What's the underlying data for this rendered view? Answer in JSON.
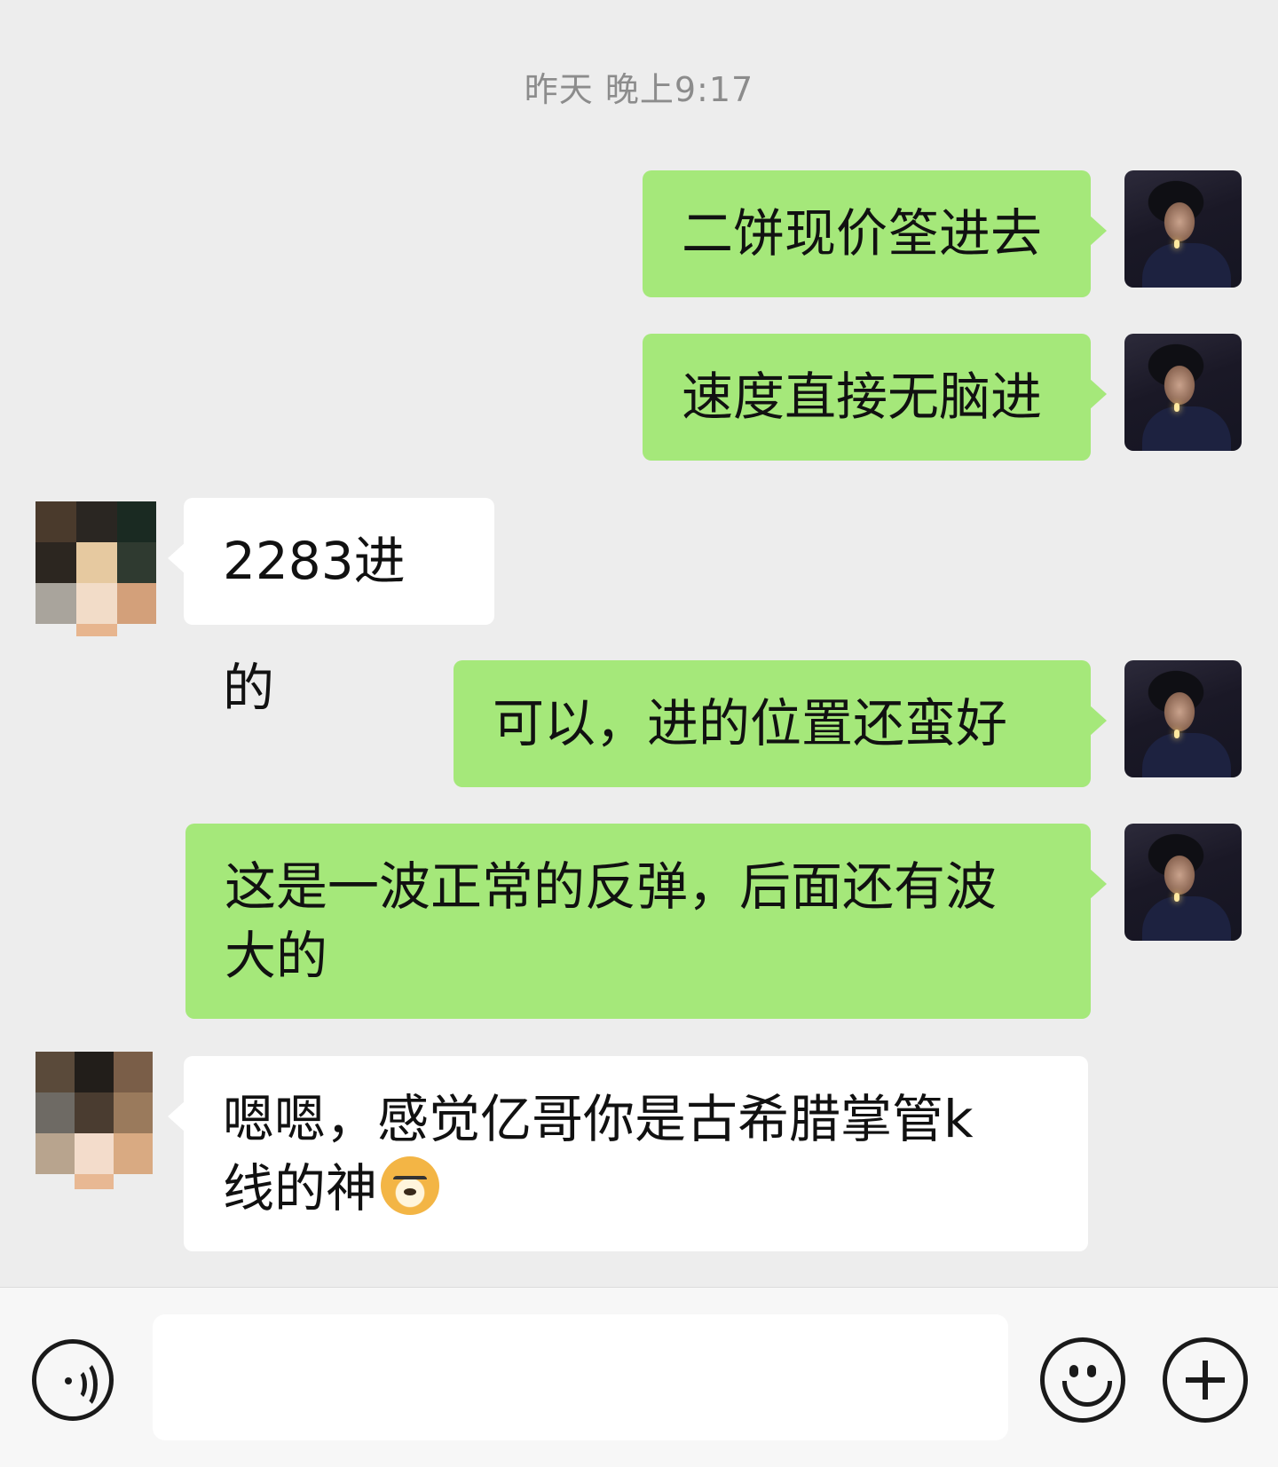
{
  "timestamp": "昨天 晚上9:17",
  "messages": [
    {
      "sender": "me",
      "text": "二饼现价筌进去"
    },
    {
      "sender": "me",
      "text": "速度直接无脑进"
    },
    {
      "sender": "other",
      "text": "2283进的"
    },
    {
      "sender": "me",
      "text": "可以，进的位置还蛮好"
    },
    {
      "sender": "me",
      "line1": "这是一波正常的反弹，后面还有波",
      "line2": "大的"
    },
    {
      "sender": "other",
      "line1": "嗯嗯，感觉亿哥你是古希腊掌管k",
      "line2": "线的神",
      "emoji": "doge-emoji"
    }
  ],
  "input": {
    "value": "",
    "placeholder": ""
  },
  "icons": {
    "voice": "voice-icon",
    "emoji": "smiley-icon",
    "more": "plus-icon"
  },
  "colors": {
    "background": "#ededed",
    "my_bubble": "#a5e87a",
    "their_bubble": "#ffffff"
  }
}
